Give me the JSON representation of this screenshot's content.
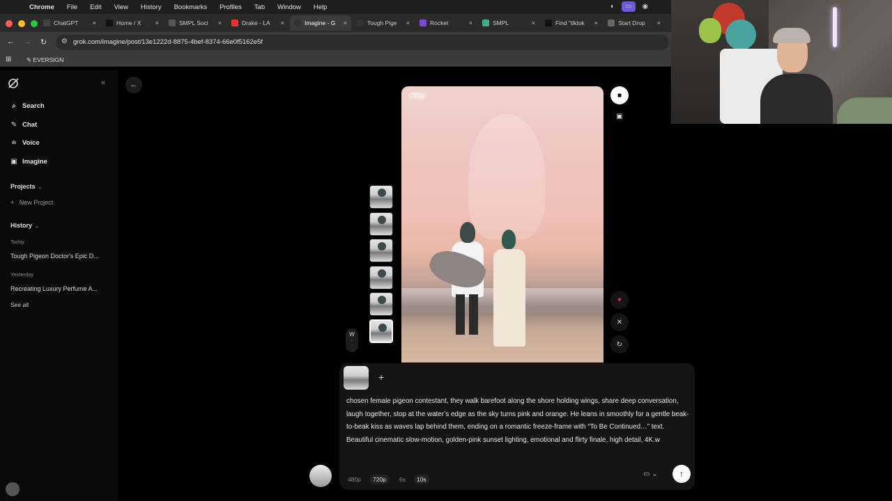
{
  "menubar": {
    "app": "Chrome",
    "items": [
      "File",
      "Edit",
      "View",
      "History",
      "Bookmarks",
      "Profiles",
      "Tab",
      "Window",
      "Help"
    ]
  },
  "tabs": [
    {
      "label": "ChatGPT",
      "fav_color": "#444"
    },
    {
      "label": "Home / X",
      "fav_color": "#111"
    },
    {
      "label": "SMPL Soci",
      "fav_color": "#555"
    },
    {
      "label": "Drake - LA",
      "fav_color": "#e33"
    },
    {
      "label": "Imagine - G",
      "fav_color": "#333"
    },
    {
      "label": "Tough Pige",
      "fav_color": "#333"
    },
    {
      "label": "Rocket",
      "fav_color": "#7b4bd6"
    },
    {
      "label": "SMPL",
      "fav_color": "#4a8"
    },
    {
      "label": "Find \"tiktok",
      "fav_color": "#111"
    },
    {
      "label": "Start Drop",
      "fav_color": "#666"
    }
  ],
  "address": {
    "url": "grok.com/imagine/post/13e1222d-8875-4bef-8374-66e0f5162e5f"
  },
  "bookmarks": {
    "item": "EVERSIGN"
  },
  "sidebar": {
    "nav": [
      {
        "label": "Search",
        "icon": "search-icon",
        "glyph": "⌕"
      },
      {
        "label": "Chat",
        "icon": "chat-icon",
        "glyph": "✎"
      },
      {
        "label": "Voice",
        "icon": "voice-icon",
        "glyph": "ılı"
      },
      {
        "label": "Imagine",
        "icon": "imagine-icon",
        "glyph": "▣"
      }
    ],
    "projects_label": "Projects",
    "new_project": "New Project",
    "history_label": "History",
    "today": "Today",
    "today_item": "Tough Pigeon Doctor's Epic D...",
    "yesterday": "Yesterday",
    "yesterday_item": "Recreating Luxury Perfume A...",
    "see_all": "See all"
  },
  "video": {
    "resolution": "720p"
  },
  "thumb_count": 6,
  "w_label": "W",
  "composer": {
    "prompt": "chosen female pigeon contestant, they walk barefoot along the shore holding wings, share deep conversation, laugh together, stop at the water’s edge as the sky turns pink and orange. He leans in smoothly for a gentle beak-to-beak kiss as waves lap behind them, ending on a romantic freeze-frame with “To Be Continued…” text. Beautiful cinematic slow-motion, golden-pink sunset lighting, emotional and flirty finale, high detail, 4K.w",
    "options": [
      {
        "label": "480p",
        "on": false
      },
      {
        "label": "720p",
        "on": true
      },
      {
        "label": "6s",
        "on": false
      },
      {
        "label": "10s",
        "on": true
      }
    ]
  },
  "colors": {
    "accent": "#ffffff",
    "like": "#e0245e",
    "background": "#000000"
  }
}
